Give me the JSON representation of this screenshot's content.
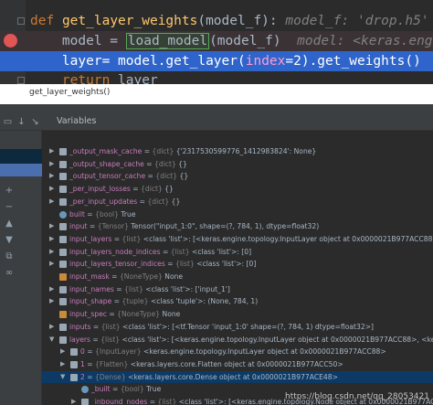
{
  "editor": {
    "line1": {
      "kw": "def",
      "name": "get_layer_weights",
      "args": "(model_f):",
      "hint": "model_f: 'drop.h5'"
    },
    "line2": {
      "lhs": "model = ",
      "call": "load_model",
      "args": "(model_f)",
      "hint": "model: <keras.engine.training"
    },
    "line3": {
      "lhs": "layer",
      "eq": "= ",
      "pre": "model.get_layer(",
      "param": "index",
      "post": "=2).get_weights()"
    },
    "line4": {
      "kw": "return",
      "rest": " layer"
    }
  },
  "breadcrumb": "get_layer_weights()",
  "debug": {
    "title": "Variables",
    "variables": [
      {
        "name": "_output_mask_cache",
        "type": "{dict}",
        "value": "{'2317530599776_1412983824': None}",
        "expand": "right",
        "indent": 0
      },
      {
        "name": "_output_shape_cache",
        "type": "{dict}",
        "value": "{}",
        "expand": "right",
        "indent": 0
      },
      {
        "name": "_output_tensor_cache",
        "type": "{dict}",
        "value": "{}",
        "expand": "right",
        "indent": 0
      },
      {
        "name": "_per_input_losses",
        "type": "{dict}",
        "value": "{}",
        "expand": "right",
        "indent": 0
      },
      {
        "name": "_per_input_updates",
        "type": "{dict}",
        "value": "{}",
        "expand": "right",
        "indent": 0
      },
      {
        "name": "built",
        "type": "{bool}",
        "value": "True",
        "expand": "none",
        "indent": 0
      },
      {
        "name": "input",
        "type": "{Tensor}",
        "value": "Tensor(\"input_1:0\", shape=(?, 784, 1), dtype=float32)",
        "expand": "right",
        "indent": 0
      },
      {
        "name": "input_layers",
        "type": "{list}",
        "value": "<class 'list'>: [<keras.engine.topology.InputLayer object at 0x0000021B977ACC88>",
        "expand": "right",
        "indent": 0
      },
      {
        "name": "input_layers_node_indices",
        "type": "{list}",
        "value": "<class 'list'>: [0]",
        "expand": "right",
        "indent": 0
      },
      {
        "name": "input_layers_tensor_indices",
        "type": "{list}",
        "value": "<class 'list'>: [0]",
        "expand": "right",
        "indent": 0
      },
      {
        "name": "input_mask",
        "type": "{NoneType}",
        "value": "None",
        "expand": "none",
        "indent": 0
      },
      {
        "name": "input_names",
        "type": "{list}",
        "value": "<class 'list'>: ['input_1']",
        "expand": "right",
        "indent": 0
      },
      {
        "name": "input_shape",
        "type": "{tuple}",
        "value": "<class 'tuple'>: (None, 784, 1)",
        "expand": "right",
        "indent": 0
      },
      {
        "name": "input_spec",
        "type": "{NoneType}",
        "value": "None",
        "expand": "none",
        "indent": 0
      },
      {
        "name": "inputs",
        "type": "{list}",
        "value": "<class 'list'>: [<tf.Tensor 'input_1:0' shape=(?, 784, 1) dtype=float32>]",
        "expand": "right",
        "indent": 0
      },
      {
        "name": "layers",
        "type": "{list}",
        "value": "<class 'list'>: [<keras.engine.topology.InputLayer object at 0x0000021B977ACC88>, <keras.layers",
        "expand": "down",
        "indent": 0
      },
      {
        "name": "0",
        "type": "{InputLayer}",
        "value": "<keras.engine.topology.InputLayer object at 0x0000021B977ACC88>",
        "expand": "right",
        "indent": 1
      },
      {
        "name": "1",
        "type": "{Flatten}",
        "value": "<keras.layers.core.Flatten object at 0x0000021B977ACC50>",
        "expand": "right",
        "indent": 1
      },
      {
        "name": "2",
        "type": "{Dense}",
        "value": "<keras.layers.core.Dense object at 0x0000021B977ACE48>",
        "expand": "down",
        "indent": 1,
        "selected": true
      },
      {
        "name": "_built",
        "type": "{bool}",
        "value": "True",
        "expand": "none",
        "indent": 2
      },
      {
        "name": "_inbound_nodes",
        "type": "{list}",
        "value": "<class 'list'>: [<keras.engine.topology.Node object at 0x0000021B977ACF08>]",
        "expand": "right",
        "indent": 2
      },
      {
        "name": "_initial_weights",
        "type": "{NoneType}",
        "value": "None",
        "expand": "none",
        "indent": 2
      }
    ]
  },
  "watermark": "https://blog.csdn.net/qq_28053421"
}
